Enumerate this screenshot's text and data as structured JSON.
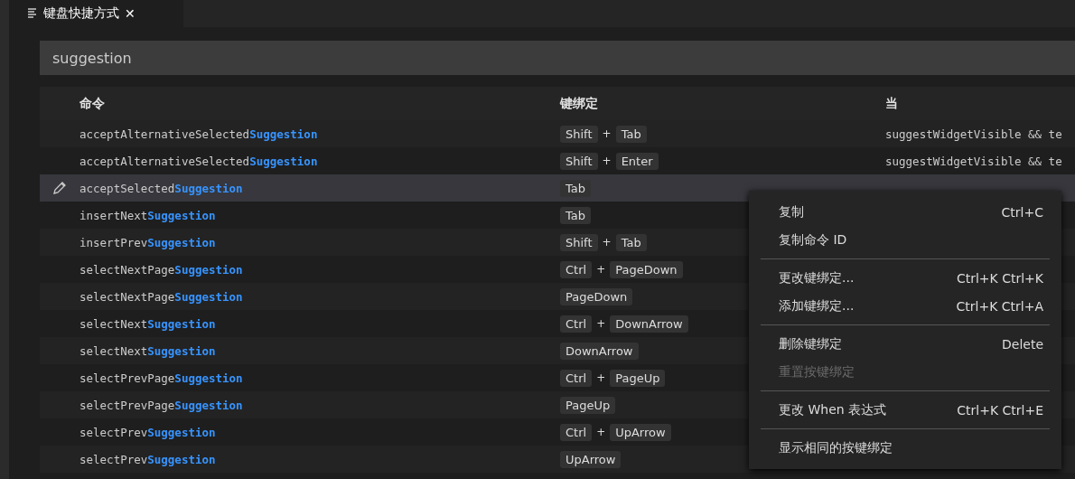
{
  "tab": {
    "title": "键盘快捷方式",
    "close": "✕"
  },
  "search": {
    "value": "suggestion"
  },
  "table": {
    "columns": [
      "命令",
      "键绑定",
      "当"
    ],
    "rows": [
      {
        "command": "acceptAlternativeSelected**Suggestion**",
        "selected": false,
        "keys": [
          {
            "kind": "key",
            "text": "Shift"
          },
          {
            "kind": "plus",
            "text": "+"
          },
          {
            "kind": "key",
            "text": "Tab"
          }
        ],
        "when": "suggestWidgetVisible && te"
      },
      {
        "command": "acceptAlternativeSelected**Suggestion**",
        "selected": false,
        "keys": [
          {
            "kind": "key",
            "text": "Shift"
          },
          {
            "kind": "plus",
            "text": "+"
          },
          {
            "kind": "key",
            "text": "Enter"
          }
        ],
        "when": "suggestWidgetVisible && te"
      },
      {
        "command": "acceptSelected**Suggestion**",
        "selected": true,
        "keys": [
          {
            "kind": "key",
            "text": "Tab"
          }
        ]
      },
      {
        "command": "insertNext**Suggestion**",
        "selected": false,
        "keys": [
          {
            "kind": "key",
            "text": "Tab"
          }
        ]
      },
      {
        "command": "insertPrev**Suggestion**",
        "selected": false,
        "keys": [
          {
            "kind": "key",
            "text": "Shift"
          },
          {
            "kind": "plus",
            "text": "+"
          },
          {
            "kind": "key",
            "text": "Tab"
          }
        ]
      },
      {
        "command": "selectNextPage**Suggestion**",
        "selected": false,
        "keys": [
          {
            "kind": "key",
            "text": "Ctrl"
          },
          {
            "kind": "plus",
            "text": "+"
          },
          {
            "kind": "key",
            "text": "PageDown"
          }
        ]
      },
      {
        "command": "selectNextPage**Suggestion**",
        "selected": false,
        "keys": [
          {
            "kind": "key",
            "text": "PageDown"
          }
        ]
      },
      {
        "command": "selectNext**Suggestion**",
        "selected": false,
        "keys": [
          {
            "kind": "key",
            "text": "Ctrl"
          },
          {
            "kind": "plus",
            "text": "+"
          },
          {
            "kind": "key",
            "text": "DownArrow"
          }
        ]
      },
      {
        "command": "selectNext**Suggestion**",
        "selected": false,
        "keys": [
          {
            "kind": "key",
            "text": "DownArrow"
          }
        ]
      },
      {
        "command": "selectPrevPage**Suggestion**",
        "selected": false,
        "keys": [
          {
            "kind": "key",
            "text": "Ctrl"
          },
          {
            "kind": "plus",
            "text": "+"
          },
          {
            "kind": "key",
            "text": "PageUp"
          }
        ]
      },
      {
        "command": "selectPrevPage**Suggestion**",
        "selected": false,
        "keys": [
          {
            "kind": "key",
            "text": "PageUp"
          }
        ]
      },
      {
        "command": "selectPrev**Suggestion**",
        "selected": false,
        "keys": [
          {
            "kind": "key",
            "text": "Ctrl"
          },
          {
            "kind": "plus",
            "text": "+"
          },
          {
            "kind": "key",
            "text": "UpArrow"
          }
        ]
      },
      {
        "command": "selectPrev**Suggestion**",
        "selected": false,
        "keys": [
          {
            "kind": "key",
            "text": "UpArrow"
          }
        ]
      }
    ]
  },
  "context_menu": {
    "groups": [
      [
        {
          "label": "复制",
          "shortcut": "Ctrl+C",
          "disabled": false
        },
        {
          "label": "复制命令 ID",
          "disabled": false
        }
      ],
      [
        {
          "label": "更改键绑定...",
          "shortcut": "Ctrl+K Ctrl+K",
          "disabled": false
        },
        {
          "label": "添加键绑定...",
          "shortcut": "Ctrl+K Ctrl+A",
          "disabled": false
        }
      ],
      [
        {
          "label": "删除键绑定",
          "shortcut": "Delete",
          "disabled": false
        },
        {
          "label": "重置按键绑定",
          "disabled": true
        }
      ],
      [
        {
          "label": "更改 When 表达式",
          "shortcut": "Ctrl+K Ctrl+E",
          "disabled": false
        }
      ],
      [
        {
          "label": "显示相同的按键绑定",
          "disabled": false
        }
      ]
    ]
  }
}
